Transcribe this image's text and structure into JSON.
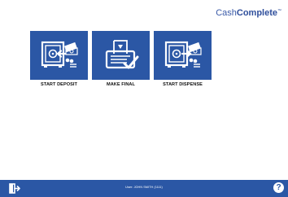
{
  "header": {
    "brand_light": "Cash",
    "brand_bold": "Complete",
    "brand_tm": "™"
  },
  "tiles": [
    {
      "label": "START DEPOSIT",
      "icon": "safe-deposit-icon"
    },
    {
      "label": "MAKE FINAL",
      "icon": "print-receipt-icon"
    },
    {
      "label": "START DISPENSE",
      "icon": "safe-dispense-icon"
    }
  ],
  "footer": {
    "user_text": "User: JOHN SMITH (1111)",
    "help_label": "?",
    "logout_icon": "logout-icon"
  },
  "colors": {
    "accent": "#2b57a5",
    "brand": "#3a5aa8"
  }
}
